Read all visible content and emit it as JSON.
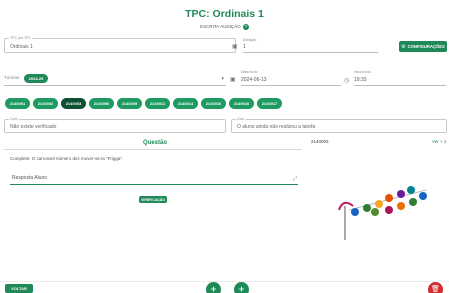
{
  "header": {
    "title": "TPC: Ordinais 1",
    "subtitle": "ESCRITA AUDIÇÃO",
    "help_icon": "?"
  },
  "form": {
    "tpc_label": "TPC por TPC",
    "tpc_value": "Ordinais 1",
    "duration_label": "Duração",
    "duration_value": "1",
    "config_button": "CONFIGURAÇÕES",
    "turma_label": "Turmas",
    "turma_chip": "2024-25",
    "start_date_label": "Data início",
    "start_date_value": "2024-06-13",
    "start_time_label": "Hora início",
    "start_time_value": "19:33"
  },
  "students": [
    "2140001",
    "2140002",
    "2140003",
    "2140006",
    "2140009",
    "2140011",
    "2140014",
    "2140016",
    "2140016",
    "2140017"
  ],
  "active_student_index": 2,
  "comments": {
    "left_label": "Com.",
    "left_value": "Não existe verificado",
    "right_label": "Com.",
    "right_value": "O aluno ainda não realizou a tarefa"
  },
  "question": {
    "title": "Questão",
    "text": "Complete: O carrossel número dez mover-se-ia \"Frigga\".",
    "answer_placeholder": "Resposta Aluno",
    "verify_button": "VERIFICAÇÃO"
  },
  "preview": {
    "student_id": "2140003",
    "link_text": "Ver + 1"
  },
  "footer": {
    "back_button": "VOLTAR",
    "add_icon": "+",
    "next_icon": "+",
    "delete_icon": "delete"
  }
}
